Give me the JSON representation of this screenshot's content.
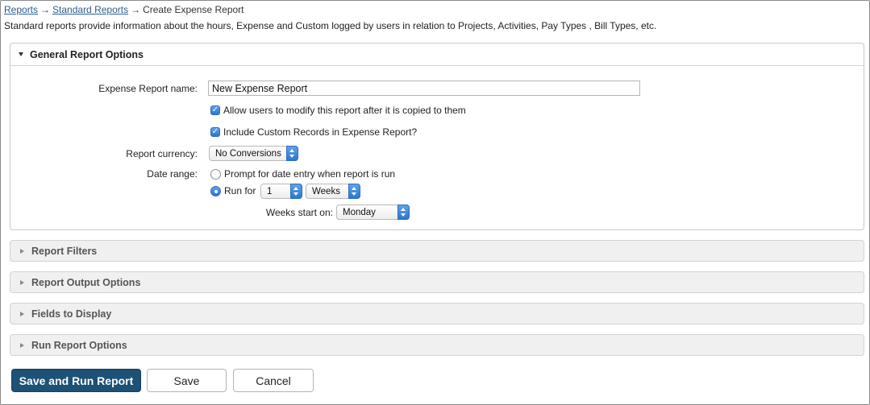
{
  "breadcrumb": {
    "items": [
      "Reports",
      "Standard Reports"
    ],
    "current": "Create Expense Report",
    "separator": "→"
  },
  "description": "Standard reports provide information about the hours, Expense and Custom logged by users in relation to Projects, Activities, Pay Types , Bill Types, etc.",
  "general_options": {
    "title": "General Report Options",
    "name_label": "Expense Report name:",
    "name_value": "New Expense Report",
    "allow_modify_label": "Allow users to modify this report after it is copied to them",
    "allow_modify_checked": true,
    "include_custom_label": "Include Custom Records in Expense Report?",
    "include_custom_checked": true,
    "currency_label": "Report currency:",
    "currency_value": "No Conversions",
    "date_range_label": "Date range:",
    "prompt_option_label": "Prompt for date entry when report is run",
    "run_for_label": "Run for",
    "run_for_count": "1",
    "run_for_unit": "Weeks",
    "selected_date_option": "run_for",
    "weeks_start_label": "Weeks start on:",
    "weeks_start_value": "Monday"
  },
  "collapsed_sections": [
    "Report Filters",
    "Report Output Options",
    "Fields to Display",
    "Run Report Options"
  ],
  "buttons": {
    "save_run": "Save and Run Report",
    "save": "Save",
    "cancel": "Cancel"
  },
  "colors": {
    "primary_button": "#1d5175",
    "link": "#2a5d8f",
    "control_accent": "#2c76d0"
  }
}
